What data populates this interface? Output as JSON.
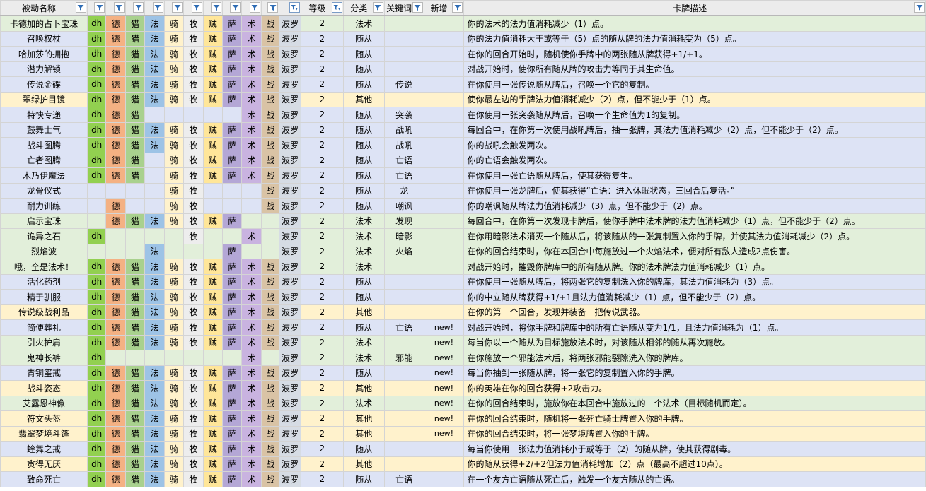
{
  "headers": [
    "被动名称",
    "",
    "",
    "",
    "",
    "",
    "",
    "",
    "",
    "",
    "",
    "",
    "等级",
    "分类",
    "关键词",
    "新增",
    "卡牌描述"
  ],
  "class_colors": {
    "dh": "#92d050",
    "德": "#f4b183",
    "猎": "#a9d18e",
    "法": "#9dc3e6",
    "骑": "#fff2cc",
    "牧": "#ededed",
    "贼": "#ffe699",
    "萨": "#b4a7d6",
    "术": "#c9b3e0",
    "战": "#d9c3a5",
    "波罗": "#d6dce4"
  },
  "row_colors": {
    "yellow": "#fff2cc",
    "green": "#e2efda",
    "blue": "#dde3f5",
    "white": "#ffffff"
  },
  "rows": [
    {
      "name": "卡德加的占卜宝珠",
      "c": [
        "dh",
        "德",
        "猎",
        "法",
        "骑",
        "牧",
        "贼",
        "萨",
        "术",
        "战",
        "波罗"
      ],
      "level": "2",
      "type": "法术",
      "kw": "",
      "new": "",
      "desc": "你的法术的法力值消耗减少（1）点。",
      "color": "green"
    },
    {
      "name": "召唤权杖",
      "c": [
        "dh",
        "德",
        "猎",
        "法",
        "骑",
        "牧",
        "贼",
        "萨",
        "术",
        "战",
        "波罗"
      ],
      "level": "2",
      "type": "随从",
      "kw": "",
      "new": "",
      "desc": "你的法力值消耗大于或等于（5）点的随从牌的法力值消耗变为（5）点。",
      "color": "blue"
    },
    {
      "name": "哈加莎的拥抱",
      "c": [
        "dh",
        "德",
        "猎",
        "法",
        "骑",
        "牧",
        "贼",
        "萨",
        "术",
        "战",
        "波罗"
      ],
      "level": "2",
      "type": "随从",
      "kw": "",
      "new": "",
      "desc": "在你的回合开始时，随机使你手牌中的两张随从牌获得+1/+1。",
      "color": "blue"
    },
    {
      "name": "潜力解锁",
      "c": [
        "dh",
        "德",
        "猎",
        "法",
        "骑",
        "牧",
        "贼",
        "萨",
        "术",
        "战",
        "波罗"
      ],
      "level": "2",
      "type": "随从",
      "kw": "",
      "new": "",
      "desc": "对战开始时，使你所有随从牌的攻击力等同于其生命值。",
      "color": "blue"
    },
    {
      "name": "传说金碟",
      "c": [
        "dh",
        "德",
        "猎",
        "法",
        "骑",
        "牧",
        "贼",
        "萨",
        "术",
        "战",
        "波罗"
      ],
      "level": "2",
      "type": "随从",
      "kw": "传说",
      "new": "",
      "desc": "在你使用一张传说随从牌后，召唤一个它的复制。",
      "color": "blue"
    },
    {
      "name": "翠绿护目镜",
      "c": [
        "dh",
        "德",
        "猎",
        "法",
        "骑",
        "牧",
        "贼",
        "萨",
        "术",
        "战",
        "波罗"
      ],
      "level": "2",
      "type": "其他",
      "kw": "",
      "new": "",
      "desc": "使你最左边的手牌法力值消耗减少（2）点，但不能少于（1）点。",
      "color": "yellow"
    },
    {
      "name": "特快专递",
      "c": [
        "dh",
        "德",
        "猎",
        "",
        "",
        "",
        "",
        "",
        "术",
        "战",
        "波罗"
      ],
      "level": "2",
      "type": "随从",
      "kw": "突袭",
      "new": "",
      "desc": "在你使用一张突袭随从牌后，召唤一个生命值为1的复制。",
      "color": "blue"
    },
    {
      "name": "鼓舞士气",
      "c": [
        "dh",
        "德",
        "猎",
        "法",
        "骑",
        "牧",
        "贼",
        "萨",
        "术",
        "战",
        "波罗"
      ],
      "level": "2",
      "type": "随从",
      "kw": "战吼",
      "new": "",
      "desc": "每回合中，在你第一次使用战吼牌后，抽一张牌，其法力值消耗减少（2）点，但不能少于（2）点。",
      "color": "blue"
    },
    {
      "name": "战斗图腾",
      "c": [
        "dh",
        "德",
        "猎",
        "法",
        "骑",
        "牧",
        "贼",
        "萨",
        "术",
        "战",
        "波罗"
      ],
      "level": "2",
      "type": "随从",
      "kw": "战吼",
      "new": "",
      "desc": "你的战吼会触发两次。",
      "color": "blue"
    },
    {
      "name": "亡者图腾",
      "c": [
        "dh",
        "德",
        "猎",
        "",
        "骑",
        "牧",
        "贼",
        "萨",
        "术",
        "战",
        "波罗"
      ],
      "level": "2",
      "type": "随从",
      "kw": "亡语",
      "new": "",
      "desc": "你的亡语会触发两次。",
      "color": "blue"
    },
    {
      "name": "木乃伊魔法",
      "c": [
        "dh",
        "德",
        "猎",
        "",
        "骑",
        "牧",
        "贼",
        "萨",
        "术",
        "战",
        "波罗"
      ],
      "level": "2",
      "type": "随从",
      "kw": "亡语",
      "new": "",
      "desc": "在你使用一张亡语随从牌后，使其获得复生。",
      "color": "blue"
    },
    {
      "name": "龙骨仪式",
      "c": [
        "",
        "",
        "",
        "",
        "骑",
        "牧",
        "",
        "",
        "",
        "战",
        "波罗"
      ],
      "level": "2",
      "type": "随从",
      "kw": "龙",
      "new": "",
      "desc": "在你使用一张龙牌后，使其获得“亡语：进入休眠状态，三回合后复活。”",
      "color": "blue"
    },
    {
      "name": "耐力训练",
      "c": [
        "",
        "德",
        "",
        "",
        "骑",
        "牧",
        "",
        "",
        "",
        "战",
        "波罗"
      ],
      "level": "2",
      "type": "随从",
      "kw": "嘲讽",
      "new": "",
      "desc": "你的嘲讽随从牌法力值消耗减少（3）点，但不能少于（2）点。",
      "color": "blue"
    },
    {
      "name": "启示宝珠",
      "c": [
        "",
        "德",
        "猎",
        "法",
        "骑",
        "牧",
        "贼",
        "萨",
        "",
        "",
        "波罗"
      ],
      "level": "2",
      "type": "法术",
      "kw": "发现",
      "new": "",
      "desc": "每回合中，在你第一次发现卡牌后，使你手牌中法术牌的法力值消耗减少（1）点，但不能少于（2）点。",
      "color": "green"
    },
    {
      "name": "诡异之石",
      "c": [
        "dh",
        "",
        "",
        "",
        "",
        "牧",
        "",
        "",
        "术",
        "",
        "波罗"
      ],
      "level": "2",
      "type": "法术",
      "kw": "暗影",
      "new": "",
      "desc": "在你用暗影法术消灭一个随从后，将该随从的一张复制置入你的手牌，并使其法力值消耗减少（2）点。",
      "color": "green"
    },
    {
      "name": "烈焰波",
      "c": [
        "",
        "",
        "",
        "法",
        "",
        "",
        "",
        "萨",
        "",
        "",
        "波罗"
      ],
      "level": "2",
      "type": "法术",
      "kw": "火焰",
      "new": "",
      "desc": "在你的回合结束时，你在本回合中每施放过一个火焰法术，便对所有敌人造成2点伤害。",
      "color": "green"
    },
    {
      "name": "哦，全是法术！",
      "c": [
        "dh",
        "德",
        "猎",
        "法",
        "骑",
        "牧",
        "贼",
        "萨",
        "术",
        "战",
        "波罗"
      ],
      "level": "2",
      "type": "法术",
      "kw": "",
      "new": "",
      "desc": "对战开始时，摧毁你牌库中的所有随从牌。你的法术牌法力值消耗减少（1）点。",
      "color": "green"
    },
    {
      "name": "活化药剂",
      "c": [
        "dh",
        "德",
        "猎",
        "法",
        "骑",
        "牧",
        "贼",
        "萨",
        "术",
        "战",
        "波罗"
      ],
      "level": "2",
      "type": "随从",
      "kw": "",
      "new": "",
      "desc": "在你使用一张随从牌后，将两张它的复制洗入你的牌库，其法力值消耗为（3）点。",
      "color": "blue"
    },
    {
      "name": "精于驯服",
      "c": [
        "dh",
        "德",
        "猎",
        "法",
        "骑",
        "牧",
        "贼",
        "萨",
        "术",
        "战",
        "波罗"
      ],
      "level": "2",
      "type": "随从",
      "kw": "",
      "new": "",
      "desc": "你的中立随从牌获得+1/+1且法力值消耗减少（1）点，但不能少于（2）点。",
      "color": "blue"
    },
    {
      "name": "传说级战利品",
      "c": [
        "dh",
        "德",
        "猎",
        "法",
        "骑",
        "牧",
        "贼",
        "萨",
        "术",
        "战",
        "波罗"
      ],
      "level": "2",
      "type": "其他",
      "kw": "",
      "new": "",
      "desc": "在你的第一个回合，发现并装备一把传说武器。",
      "color": "yellow"
    },
    {
      "name": "简便葬礼",
      "c": [
        "dh",
        "德",
        "猎",
        "法",
        "骑",
        "牧",
        "贼",
        "萨",
        "术",
        "战",
        "波罗"
      ],
      "level": "2",
      "type": "随从",
      "kw": "亡语",
      "new": "new!",
      "desc": "对战开始时，将你手牌和牌库中的所有亡语随从变为1/1，且法力值消耗为（1）点。",
      "color": "blue"
    },
    {
      "name": "引火护肩",
      "c": [
        "dh",
        "德",
        "猎",
        "法",
        "骑",
        "牧",
        "贼",
        "萨",
        "术",
        "战",
        "波罗"
      ],
      "level": "2",
      "type": "法术",
      "kw": "",
      "new": "new!",
      "desc": "每当你以一个随从为目标施放法术时，对该随从相邻的随从再次施放。",
      "color": "green"
    },
    {
      "name": "鬼神长裤",
      "c": [
        "dh",
        "",
        "",
        "",
        "",
        "",
        "",
        "",
        "术",
        "",
        "波罗"
      ],
      "level": "2",
      "type": "法术",
      "kw": "邪能",
      "new": "new!",
      "desc": "在你施放一个邪能法术后，将两张邪能裂隙洗入你的牌库。",
      "color": "green"
    },
    {
      "name": "青铜玺戒",
      "c": [
        "dh",
        "德",
        "猎",
        "法",
        "骑",
        "牧",
        "贼",
        "萨",
        "术",
        "战",
        "波罗"
      ],
      "level": "2",
      "type": "随从",
      "kw": "",
      "new": "new!",
      "desc": "每当你抽到一张随从牌，将一张它的复制置入你的手牌。",
      "color": "blue"
    },
    {
      "name": "战斗姿态",
      "c": [
        "dh",
        "德",
        "猎",
        "法",
        "骑",
        "牧",
        "贼",
        "萨",
        "术",
        "战",
        "波罗"
      ],
      "level": "2",
      "type": "其他",
      "kw": "",
      "new": "new!",
      "desc": "你的英雄在你的回合获得+2攻击力。",
      "color": "yellow"
    },
    {
      "name": "艾露恩神像",
      "c": [
        "dh",
        "德",
        "猎",
        "法",
        "骑",
        "牧",
        "贼",
        "萨",
        "术",
        "战",
        "波罗"
      ],
      "level": "2",
      "type": "法术",
      "kw": "",
      "new": "new!",
      "desc": "在你的回合结束时，施放你在本回合中施放过的一个法术（目标随机而定）。",
      "color": "green"
    },
    {
      "name": "符文头盔",
      "c": [
        "dh",
        "德",
        "猎",
        "法",
        "骑",
        "牧",
        "贼",
        "萨",
        "术",
        "战",
        "波罗"
      ],
      "level": "2",
      "type": "其他",
      "kw": "",
      "new": "new!",
      "desc": "在你的回合结束时，随机将一张死亡骑士牌置入你的手牌。",
      "color": "yellow"
    },
    {
      "name": "翡翠梦境斗篷",
      "c": [
        "dh",
        "德",
        "猎",
        "法",
        "骑",
        "牧",
        "贼",
        "萨",
        "术",
        "战",
        "波罗"
      ],
      "level": "2",
      "type": "其他",
      "kw": "",
      "new": "new!",
      "desc": "在你的回合结束时，将一张梦境牌置入你的手牌。",
      "color": "yellow"
    },
    {
      "name": "蝰舞之戒",
      "c": [
        "dh",
        "德",
        "猎",
        "法",
        "骑",
        "牧",
        "贼",
        "萨",
        "术",
        "战",
        "波罗"
      ],
      "level": "2",
      "type": "随从",
      "kw": "",
      "new": "",
      "desc": "每当你使用一张法力值消耗小于或等于（2）的随从牌，使其获得剧毒。",
      "color": "blue"
    },
    {
      "name": "贪得无厌",
      "c": [
        "dh",
        "德",
        "猎",
        "法",
        "骑",
        "牧",
        "贼",
        "萨",
        "术",
        "战",
        "波罗"
      ],
      "level": "2",
      "type": "其他",
      "kw": "",
      "new": "",
      "desc": "你的随从获得+2/+2但法力值消耗增加（2）点（最高不超过10点）。",
      "color": "yellow"
    },
    {
      "name": "致命死亡",
      "c": [
        "dh",
        "德",
        "猎",
        "法",
        "骑",
        "牧",
        "贼",
        "萨",
        "术",
        "战",
        "波罗"
      ],
      "level": "2",
      "type": "随从",
      "kw": "亡语",
      "new": "",
      "desc": "在一个友方亡语随从死亡后，触发一个友方随从的亡语。",
      "color": "blue"
    }
  ]
}
